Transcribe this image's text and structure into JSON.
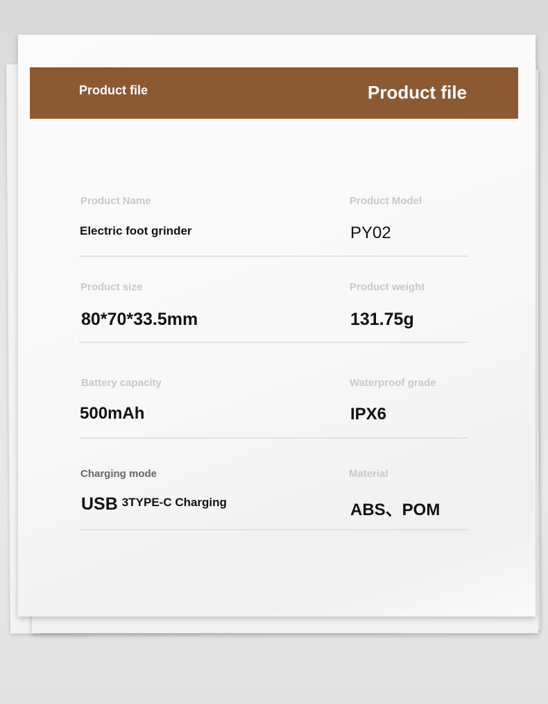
{
  "banner": {
    "left_title": "Product file",
    "right_title": "Product file"
  },
  "specs": [
    {
      "left": {
        "label": "Product Name",
        "value": "Electric foot grinder"
      },
      "right": {
        "label": "Product Model",
        "value": "PY02"
      }
    },
    {
      "left": {
        "label": "Product size",
        "value": "80*70*33.5mm"
      },
      "right": {
        "label": "Product weight",
        "value": "131.75g"
      }
    },
    {
      "left": {
        "label": "Battery capacity",
        "value": "500mAh"
      },
      "right": {
        "label": "Waterproof grade",
        "value": "IPX6"
      }
    },
    {
      "left": {
        "label": "Charging mode",
        "value_main": "USB",
        "value_sub": "3TYPE-C Charging"
      },
      "right": {
        "label": "Material",
        "value": "ABS、POM"
      }
    }
  ],
  "colors": {
    "banner": "#8b5a32",
    "label": "#c9c9c9",
    "value": "#111111",
    "divider": "#e1e1e1"
  }
}
